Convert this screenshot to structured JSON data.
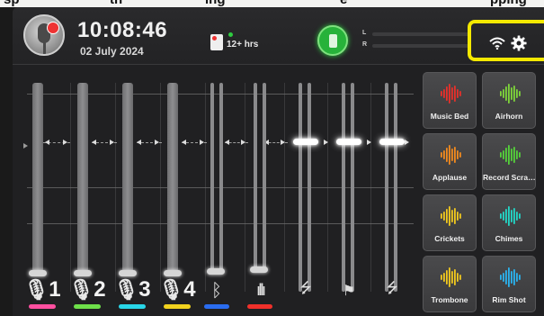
{
  "top_cut_text": [
    "sp",
    "th",
    "ing",
    "e",
    "pping"
  ],
  "header": {
    "time": "10:08:46",
    "date": "02 July 2024",
    "recording_time_remaining": "12+ hrs",
    "meter_left_label": "L",
    "meter_right_label": "R",
    "icons": {
      "avatar": "podcast-avatar",
      "recording": "sd-card-icon",
      "power": "battery-icon",
      "wifi": "wifi-icon",
      "settings": "gear-icon"
    },
    "highlight_color": "#f4e900"
  },
  "channels": [
    {
      "icon": "mic-icon",
      "label": "1",
      "color": "#ff4fa0"
    },
    {
      "icon": "mic-icon",
      "label": "2",
      "color": "#6ee04a"
    },
    {
      "icon": "mic-icon",
      "label": "3",
      "color": "#29d6e8"
    },
    {
      "icon": "mic-icon",
      "label": "4",
      "color": "#f2d21e"
    },
    {
      "icon": "bluetooth-icon",
      "label": "",
      "color": "#2a6cf0"
    },
    {
      "icon": "sound-pads-icon",
      "label": "",
      "color": "#f0302a"
    },
    {
      "icon": "usb-1-icon",
      "label": "",
      "color": ""
    },
    {
      "icon": "usb-flag-icon",
      "label": "",
      "color": ""
    },
    {
      "icon": "usb-2-icon",
      "label": "",
      "color": ""
    }
  ],
  "pads": [
    {
      "label": "Music Bed",
      "color": "#e8302a"
    },
    {
      "label": "Airhorn",
      "color": "#7ed63a"
    },
    {
      "label": "Applause",
      "color": "#f28a1e"
    },
    {
      "label": "Record Scra…",
      "color": "#55d23a"
    },
    {
      "label": "Crickets",
      "color": "#f2c91e"
    },
    {
      "label": "Chimes",
      "color": "#22d8c8"
    },
    {
      "label": "Trombone",
      "color": "#f2c91e"
    },
    {
      "label": "Rim Shot",
      "color": "#2ab4f0"
    }
  ]
}
